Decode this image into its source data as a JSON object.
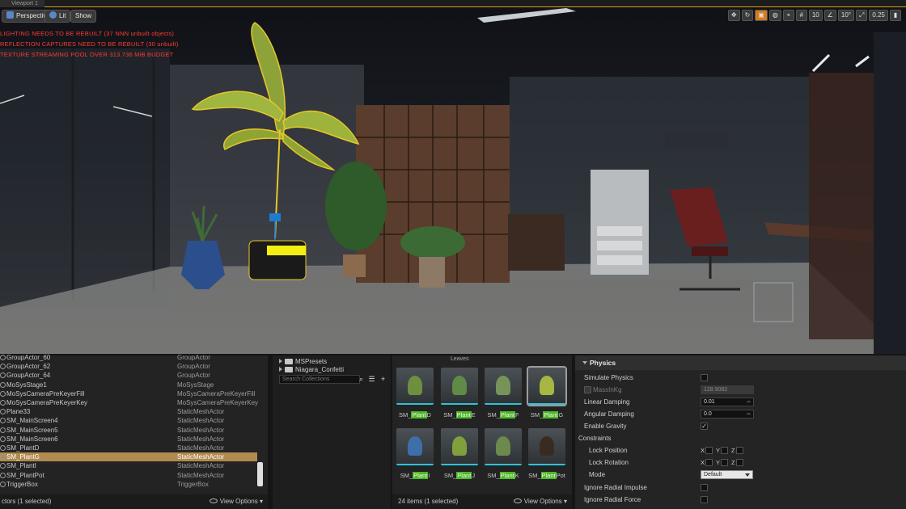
{
  "viewport": {
    "tab_title": "Viewport 1",
    "perspective_label": "Perspective",
    "lit_label": "Lit",
    "show_label": "Show",
    "warnings": [
      "LIGHTING NEEDS TO BE REBUILT (37 NNN unbuilt objects)",
      "REFLECTION CAPTURES NEED TO BE REBUILT (30 unbuilt)",
      "TEXTURE STREAMING POOL OVER 313.736 MiB BUDGET"
    ],
    "toolbar": {
      "grid_snap": "10",
      "rotation_snap": "10°",
      "scale_snap": "0.25"
    }
  },
  "outliner": {
    "rows": [
      {
        "name": "GroupActor_60",
        "type": "GroupActor"
      },
      {
        "name": "GroupActor_62",
        "type": "GroupActor"
      },
      {
        "name": "GroupActor_64",
        "type": "GroupActor"
      },
      {
        "name": "MoSysStage1",
        "type": "MoSysStage"
      },
      {
        "name": "MoSysCameraPreKeyerFill",
        "type": "MoSysCameraPreKeyerFill"
      },
      {
        "name": "MoSysCameraPreKeyerKey",
        "type": "MoSysCameraPreKeyerKey"
      },
      {
        "name": "Plane33",
        "type": "StaticMeshActor"
      },
      {
        "name": "SM_MainScreen4",
        "type": "StaticMeshActor"
      },
      {
        "name": "SM_MainScreen5",
        "type": "StaticMeshActor"
      },
      {
        "name": "SM_MainScreen6",
        "type": "StaticMeshActor"
      },
      {
        "name": "SM_PlantD",
        "type": "StaticMeshActor"
      },
      {
        "name": "SM_PlantG",
        "type": "StaticMeshActor",
        "selected": true
      },
      {
        "name": "SM_PlantI",
        "type": "StaticMeshActor"
      },
      {
        "name": "SM_PlantPot",
        "type": "StaticMeshActor"
      },
      {
        "name": "TriggerBox",
        "type": "TriggerBox"
      }
    ],
    "footer_count": "ctors (1 selected)",
    "view_options": "View Options"
  },
  "collections": {
    "folders": [
      "MSPresets",
      "Niagara_Confetti"
    ],
    "search_placeholder": "Search Collections"
  },
  "assets": {
    "top_label": "Leaves",
    "tiles": [
      {
        "prefix": "SM_",
        "highlight": "Plant",
        "suffix": "D"
      },
      {
        "prefix": "SM_",
        "highlight": "Plant",
        "suffix": "E"
      },
      {
        "prefix": "SM_",
        "highlight": "Plant",
        "suffix": "F"
      },
      {
        "prefix": "SM_",
        "highlight": "Plant",
        "suffix": "G",
        "selected": true
      },
      {
        "prefix": "SM_",
        "highlight": "Plant",
        "suffix": "I"
      },
      {
        "prefix": "SM_",
        "highlight": "Plant",
        "suffix": "J"
      },
      {
        "prefix": "SM_",
        "highlight": "Plant",
        "suffix": "K"
      },
      {
        "prefix": "SM_",
        "highlight": "Plant",
        "suffix": "Pot"
      }
    ],
    "footer_count": "24 items (1 selected)",
    "view_options": "View Options"
  },
  "details": {
    "section_title": "Physics",
    "simulate_physics": "Simulate Physics",
    "mass_in_kg_label": "MassInKg",
    "mass_in_kg_value": "128.9082",
    "linear_damping_label": "Linear Damping",
    "linear_damping_value": "0.01",
    "angular_damping_label": "Angular Damping",
    "angular_damping_value": "0.0",
    "enable_gravity_label": "Enable Gravity",
    "constraints_label": "Constraints",
    "lock_position_label": "Lock Position",
    "lock_rotation_label": "Lock Rotation",
    "axis_x": "X",
    "axis_y": "Y",
    "axis_z": "Z",
    "mode_label": "Mode",
    "mode_value": "Default",
    "ignore_radial_impulse_label": "Ignore Radial Impulse",
    "ignore_radial_force_label": "Ignore Radial Force"
  },
  "colors": {
    "accent": "#d9a11f",
    "selection": "#b08a4e",
    "asset_bar": "#2ec4d8",
    "warning": "#ff3b30"
  }
}
